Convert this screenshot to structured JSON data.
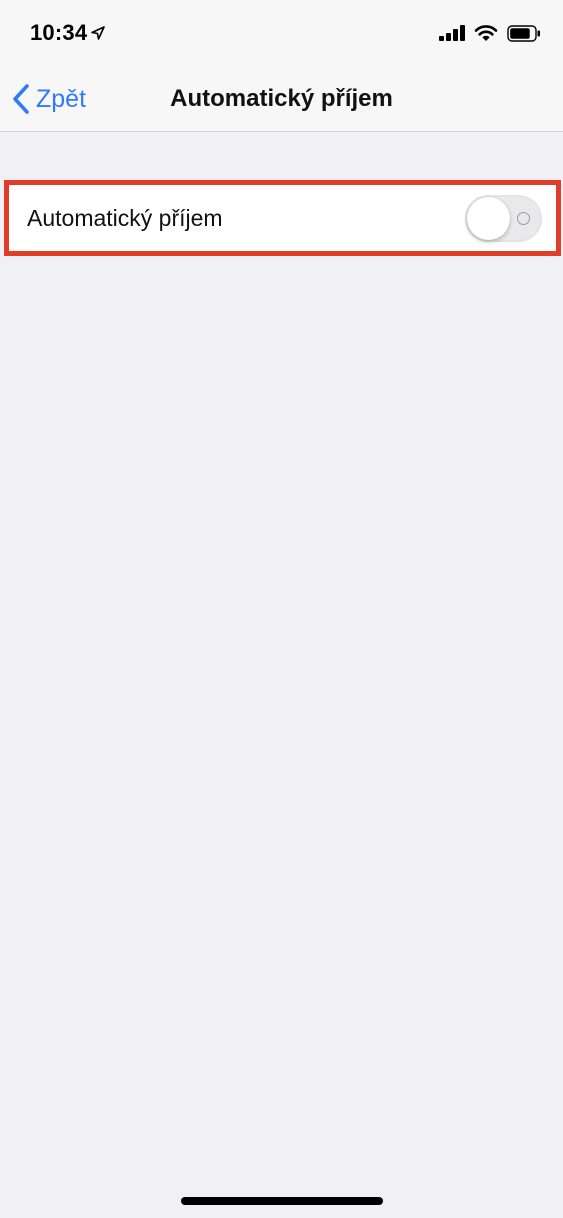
{
  "status_bar": {
    "time": "10:34",
    "icons": [
      "location-arrow-icon",
      "signal-icon",
      "wifi-icon",
      "battery-icon"
    ]
  },
  "nav": {
    "back_label": "Zpět",
    "title": "Automatický příjem"
  },
  "settings": {
    "auto_answer_label": "Automatický příjem",
    "auto_answer_enabled": false
  },
  "colors": {
    "accent": "#2f7cf6",
    "highlight_border": "#e23d28",
    "background": "#f1f0f5"
  }
}
